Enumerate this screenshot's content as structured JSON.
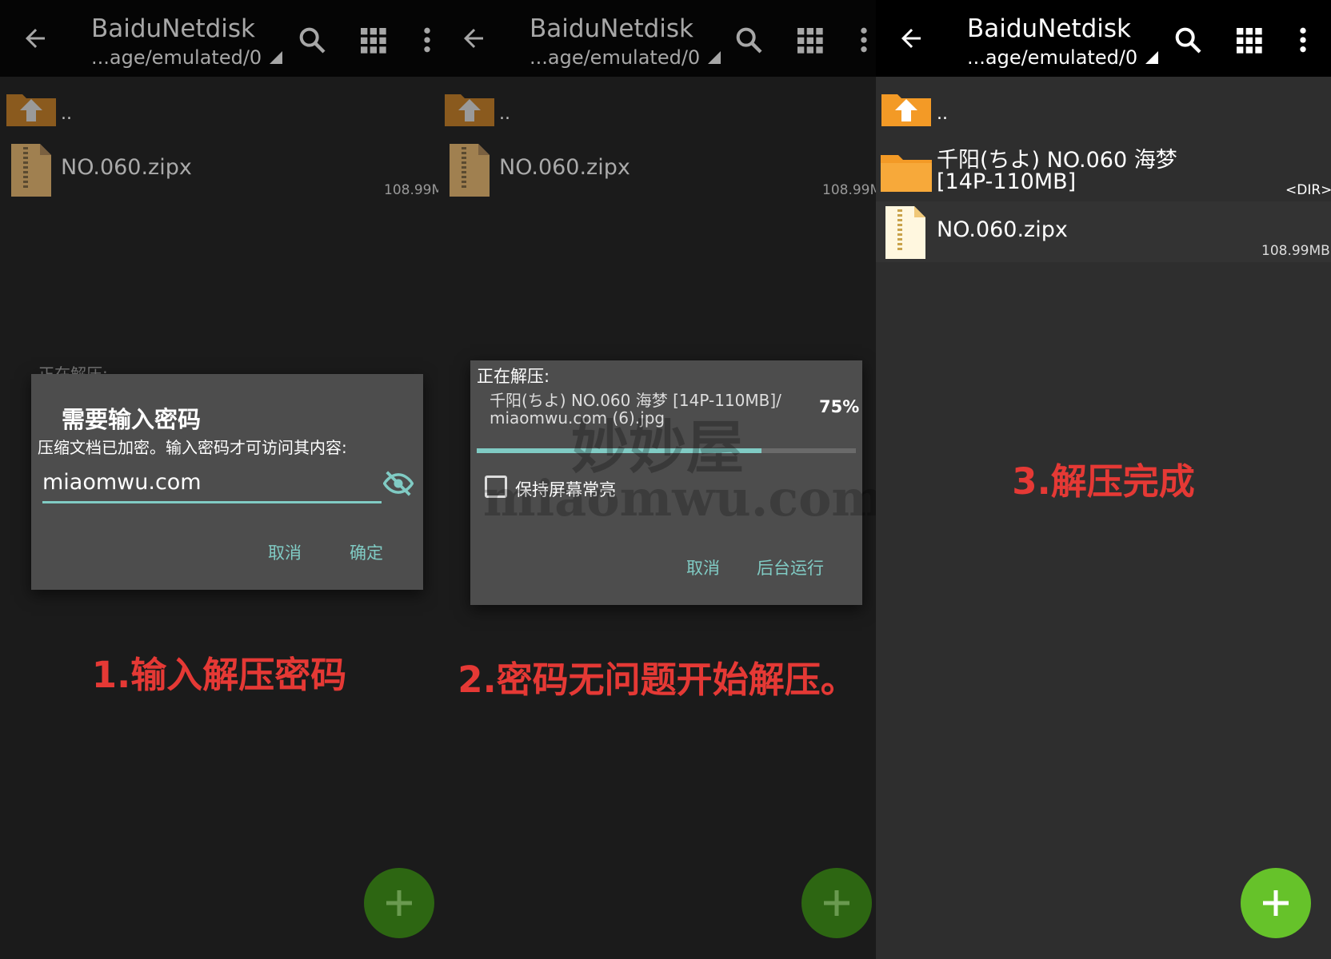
{
  "appbar": {
    "title": "BaiduNetdisk",
    "path": "...age/emulated/0"
  },
  "files": {
    "parent": "..",
    "zip_name": "NO.060.zipx",
    "zip_size_short": "108.99M",
    "zip_size": "108.99MB",
    "folder_line1": "千阳(ちよ) NO.060 海梦",
    "folder_line2": "[14P-110MB]",
    "dir_tag": "<DIR>"
  },
  "step1": {
    "ghost_label": "正在解压:",
    "dialog_title": "需要输入密码",
    "dialog_message": "压缩文档已加密。输入密码才可访问其内容:",
    "password_value": "miaomwu.com",
    "cancel": "取消",
    "ok": "确定",
    "caption": "1.输入解压密码"
  },
  "step2": {
    "label": "正在解压:",
    "file_line1": "千阳(ちよ) NO.060 海梦 [14P-110MB]/",
    "file_line2": "miaomwu.com (6).jpg",
    "percent": "75%",
    "progress": 0.75,
    "keep_screen_on": "保持屏幕常亮",
    "cancel": "取消",
    "background": "后台运行",
    "watermark_cn": "妙妙屋",
    "watermark_en": "miaomwu.com",
    "caption": "2.密码无问题开始解压。"
  },
  "step3": {
    "caption": "3.解压完成"
  },
  "colors": {
    "accent": "#80cbc4",
    "caption_red": "#e53935",
    "fab_green": "#66c22a",
    "folder_orange": "#f39a26"
  },
  "icons": [
    "back-arrow-icon",
    "search-icon",
    "grid-icon",
    "more-vert-icon",
    "folder-up-icon",
    "zip-file-icon",
    "folder-icon",
    "eye-off-icon",
    "plus-icon"
  ]
}
